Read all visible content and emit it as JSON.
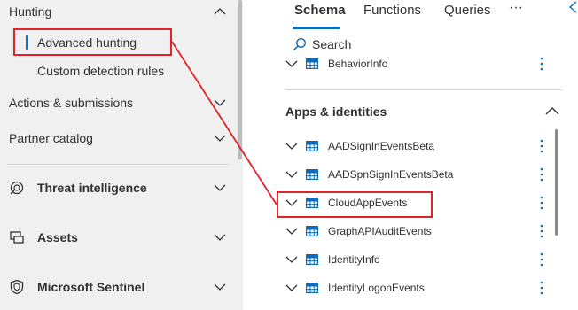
{
  "nav": {
    "hunting": "Hunting",
    "advanced_hunting": "Advanced hunting",
    "custom_detection_rules": "Custom detection rules",
    "actions_submissions": "Actions & submissions",
    "partner_catalog": "Partner catalog",
    "threat_intelligence": "Threat intelligence",
    "assets": "Assets",
    "microsoft_sentinel": "Microsoft Sentinel"
  },
  "tabs": {
    "schema": "Schema",
    "functions": "Functions",
    "queries": "Queries",
    "more": "···"
  },
  "search": {
    "label": "Search"
  },
  "schema": {
    "top_item": "BehaviorInfo",
    "section_title": "Apps & identities",
    "items": [
      "AADSignInEventsBeta",
      "AADSpnSignInEventsBeta",
      "CloudAppEvents",
      "GraphAPIAuditEvents",
      "IdentityInfo",
      "IdentityLogonEvents"
    ]
  },
  "colors": {
    "accent": "#0f6cbd",
    "annotation": "#e3212b",
    "nav_background": "#f0f0f0"
  }
}
